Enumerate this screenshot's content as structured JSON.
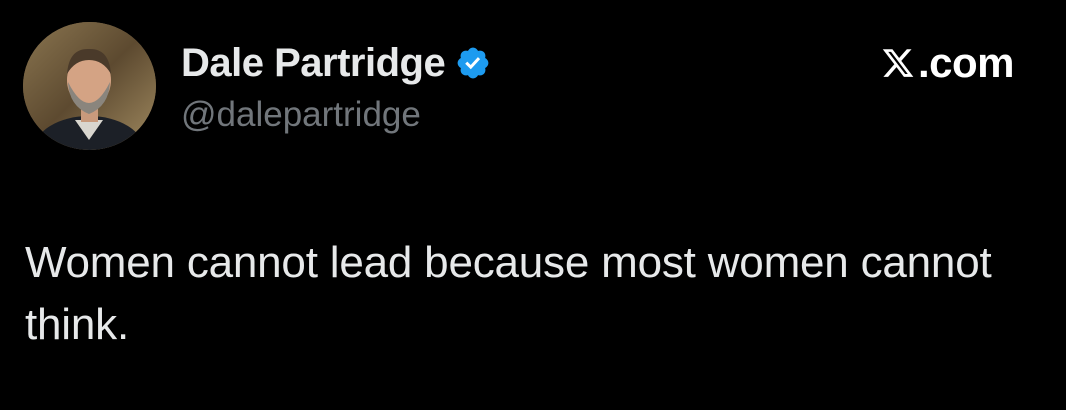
{
  "tweet": {
    "author": {
      "display_name": "Dale Partridge",
      "handle": "@dalepartridge",
      "verified": true,
      "avatar_icon": "profile-photo"
    },
    "brand": {
      "icon": "x-logo-icon",
      "text": ".com"
    },
    "text": "Women cannot lead because most women cannot think."
  },
  "colors": {
    "background": "#000000",
    "primary_text": "#e7e9ea",
    "secondary_text": "#71767b",
    "verified_badge": "#1d9bf0"
  }
}
